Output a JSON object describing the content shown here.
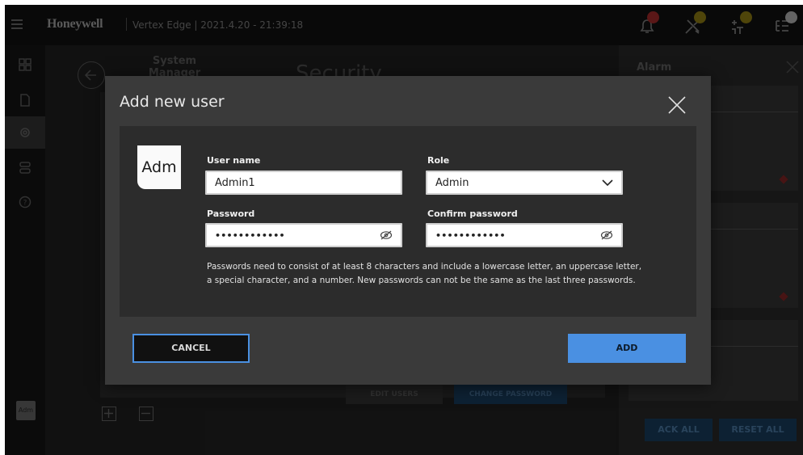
{
  "header": {
    "brand": "Honeywell",
    "subtitle": "Vertex Edge | 2021.4.20 - 21:39:18",
    "icons": [
      {
        "name": "bell-icon",
        "badge_color": "#e23b3b"
      },
      {
        "name": "tools-icon",
        "badge_color": "#e6b800"
      },
      {
        "name": "network-icon",
        "badge_color": "#e6b800"
      },
      {
        "name": "list-settings-icon",
        "badge_color": "#ffffff"
      }
    ]
  },
  "sidebar": {
    "items": [
      "dashboard-icon",
      "document-icon",
      "settings-icon",
      "devices-icon",
      "help-icon"
    ],
    "active_index": 2,
    "user_initials": "Adm"
  },
  "background_page": {
    "back_icon": "arrow-left-icon",
    "section": "System Manager",
    "title": "Security",
    "edit_users": "EDIT USERS",
    "change_password": "CHANGE PASSWORD"
  },
  "alarm_panel": {
    "title": "Alarm",
    "ack_all": "ACK ALL",
    "reset_all": "RESET ALL"
  },
  "modal": {
    "title": "Add new user",
    "avatar_initials": "Adm",
    "username_label": "User name",
    "username_value": "Admin1",
    "role_label": "Role",
    "role_value": "Admin",
    "password_label": "Password",
    "password_value": "••••••••••••",
    "confirm_label": "Confirm password",
    "confirm_value": "••••••••••••",
    "help_text": "Passwords need to consist of at least 8 characters and include a lowercase letter, an uppercase letter, a special character, and a number. New passwords can not be the same as the last three passwords.",
    "cancel_label": "CANCEL",
    "add_label": "ADD"
  },
  "colors": {
    "accent": "#4a90e2",
    "modal_bg": "#3a3a3a",
    "body_bg": "#2c2c2c"
  }
}
